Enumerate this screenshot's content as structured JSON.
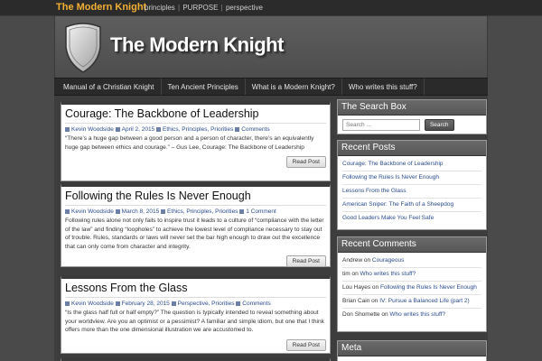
{
  "top": {
    "site_name": "The Modern Knight",
    "tagline": [
      "principles",
      "PURPOSE",
      "perspective"
    ]
  },
  "header": {
    "brand": "The Modern Knight",
    "logo_icon": "shield-icon"
  },
  "nav": [
    "Manual of a Christian Knight",
    "Ten Ancient Principles",
    "What is a Modern Knight?",
    "Who writes this stuff?"
  ],
  "posts": [
    {
      "title": "Courage: The Backbone of Leadership",
      "author": "Kevin Woodside",
      "date": "April 2, 2015",
      "categories": "Ethics, Principles, Priorities",
      "comments": "Comments",
      "excerpt": "“There’s a huge gap between a good person and a person of character, there’s an equivalently huge gap between ethics and courage.” – Gus Lee, Courage: The Backbone of Leadership",
      "read_more": "Read Post"
    },
    {
      "title": "Following the Rules Is Never Enough",
      "author": "Kevin Woodside",
      "date": "March 8, 2015",
      "categories": "Ethics, Principles, Priorities",
      "comments": "1 Comment",
      "excerpt": "Following rules alone not only fails to inspire trust it leads to a culture of “compliance with the letter of the law” and finding “loopholes” to achieve the lowest level of compliance necessary to stay out of trouble. Rules, standards or laws will never set the bar high enough to draw out the excellence that can only come from character and integrity.",
      "read_more": "Read Post"
    },
    {
      "title": "Lessons From the Glass",
      "author": "Kevin Woodside",
      "date": "February 28, 2015",
      "categories": "Perspective, Priorities",
      "comments": "Comments",
      "excerpt": "“Is the glass half full or half empty?” The question is typically intended to reveal something about your worldview. Are you an optimist or a pessimist? A familiar and simple idiom, but one that I think offers more than the one dimensional illustration we are accustomed to.",
      "read_more": "Read Post"
    }
  ],
  "sidebar": {
    "search": {
      "title": "The Search Box",
      "placeholder": "Search ...",
      "button": "Search"
    },
    "recent_posts": {
      "title": "Recent Posts",
      "items": [
        "Courage: The Backbone of Leadership",
        "Following the Rules Is Never Enough",
        "Lessons From the Glass",
        "American Sniper: The Faith of a Sheepdog",
        "Good Leaders Make You Feel Safe"
      ]
    },
    "recent_comments": {
      "title": "Recent Comments",
      "items": [
        {
          "author": "Andrew",
          "on": "on",
          "post": "Courageous"
        },
        {
          "author": "tim",
          "on": "on",
          "post": "Who writes this stuff?"
        },
        {
          "author": "Lou Hayes",
          "on": "on",
          "post": "Following the Rules Is Never Enough"
        },
        {
          "author": "Brian Cain",
          "on": "on",
          "post": "IV: Pursue a Balanced Life (part 2)"
        },
        {
          "author": "Don Shomette",
          "on": "on",
          "post": "Who writes this stuff?"
        }
      ]
    },
    "meta": {
      "title": "Meta"
    }
  },
  "colors": {
    "accent": "#f2b035",
    "link": "#2a4b8d",
    "background": "#4a4a4a"
  }
}
